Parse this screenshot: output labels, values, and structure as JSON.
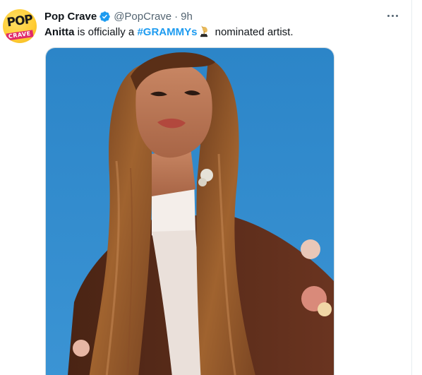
{
  "tweet": {
    "author_name": "Pop Crave",
    "handle": "@PopCrave",
    "separator": "·",
    "time": "9h",
    "text_before": "Anitta",
    "text_mid": " is officially a ",
    "hashtag": "#GRAMMYs",
    "text_after": " nominated artist."
  },
  "avatar": {
    "line1": "POP",
    "line2": "CRAVE"
  },
  "icons": {
    "verified": "verified-badge-icon",
    "grammy": "grammy-trophy-icon",
    "more": "more-options-icon"
  },
  "colors": {
    "accent": "#1d9bf0",
    "avatar_bg": "#ffcc33",
    "photo_sky": "#2d86c8"
  }
}
